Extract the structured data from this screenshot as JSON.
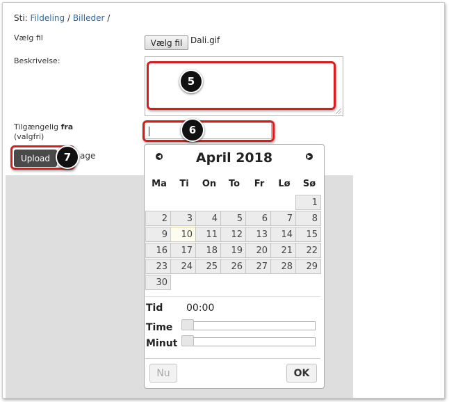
{
  "breadcrumb": {
    "prefix": "Sti:",
    "items": [
      "Fildeling",
      "Billeder"
    ],
    "separator": "/"
  },
  "form": {
    "file_label": "Vælg fil",
    "file_button": "Vælg fil",
    "file_name": "Dali.gif",
    "description_label": "Beskrivelse:",
    "available_label_1": "Tilgængelig",
    "available_label_bold": "fra",
    "available_label_2": "(valgfri)",
    "upload_button": "Upload",
    "partial_text": "age"
  },
  "callouts": {
    "description": "5",
    "date": "6",
    "upload": "7",
    "color": "#d81b1b"
  },
  "datepicker": {
    "month_title": "April 2018",
    "prev_icon": "◀",
    "next_icon": "▶",
    "weekdays": [
      "Ma",
      "Ti",
      "On",
      "To",
      "Fr",
      "Lø",
      "Sø"
    ],
    "days": [
      "1",
      "2",
      "3",
      "4",
      "5",
      "6",
      "7",
      "8",
      "9",
      "10",
      "11",
      "12",
      "13",
      "14",
      "15",
      "16",
      "17",
      "18",
      "19",
      "20",
      "21",
      "22",
      "23",
      "24",
      "25",
      "26",
      "27",
      "28",
      "29",
      "30"
    ],
    "today": "10",
    "time_label": "Tid",
    "time_value": "00:00",
    "hour_label": "Time",
    "minute_label": "Minut",
    "now_button": "Nu",
    "ok_button": "OK"
  }
}
